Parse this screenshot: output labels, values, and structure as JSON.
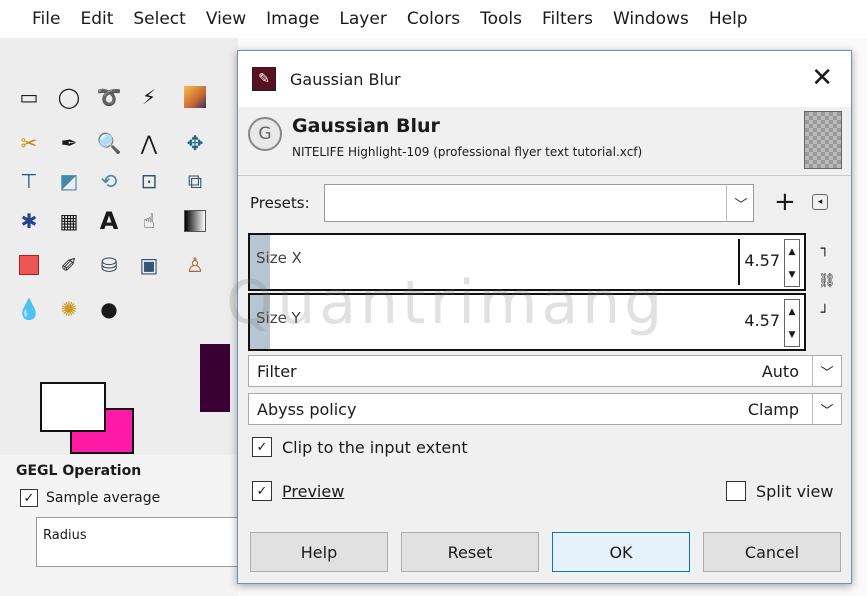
{
  "menubar": {
    "items": [
      "File",
      "Edit",
      "Select",
      "View",
      "Image",
      "Layer",
      "Colors",
      "Tools",
      "Filters",
      "Windows",
      "Help"
    ]
  },
  "gegl": {
    "title": "GEGL Operation",
    "sample_average": "Sample average",
    "radius_label": "Radius"
  },
  "dialog": {
    "window_title": "Gaussian Blur",
    "close_glyph": "✕",
    "header_title": "Gaussian Blur",
    "header_subtitle": "NITELIFE Highlight-109 (professional flyer text tutorial.xcf)",
    "presets_label": "Presets:",
    "size_x": {
      "label": "Size X",
      "value": "4.57"
    },
    "size_y": {
      "label": "Size Y",
      "value": "4.57"
    },
    "filter": {
      "label": "Filter",
      "value": "Auto"
    },
    "abyss": {
      "label": "Abyss policy",
      "value": "Clamp"
    },
    "clip_label": "Clip to the input extent",
    "preview_label": "Preview",
    "split_view_label": "Split view",
    "buttons": {
      "help": "Help",
      "reset": "Reset",
      "ok": "OK",
      "cancel": "Cancel"
    }
  },
  "watermark": "Quantrimang",
  "colors": {
    "accent": "#0078d7",
    "background_color": "#ff1aa6"
  }
}
